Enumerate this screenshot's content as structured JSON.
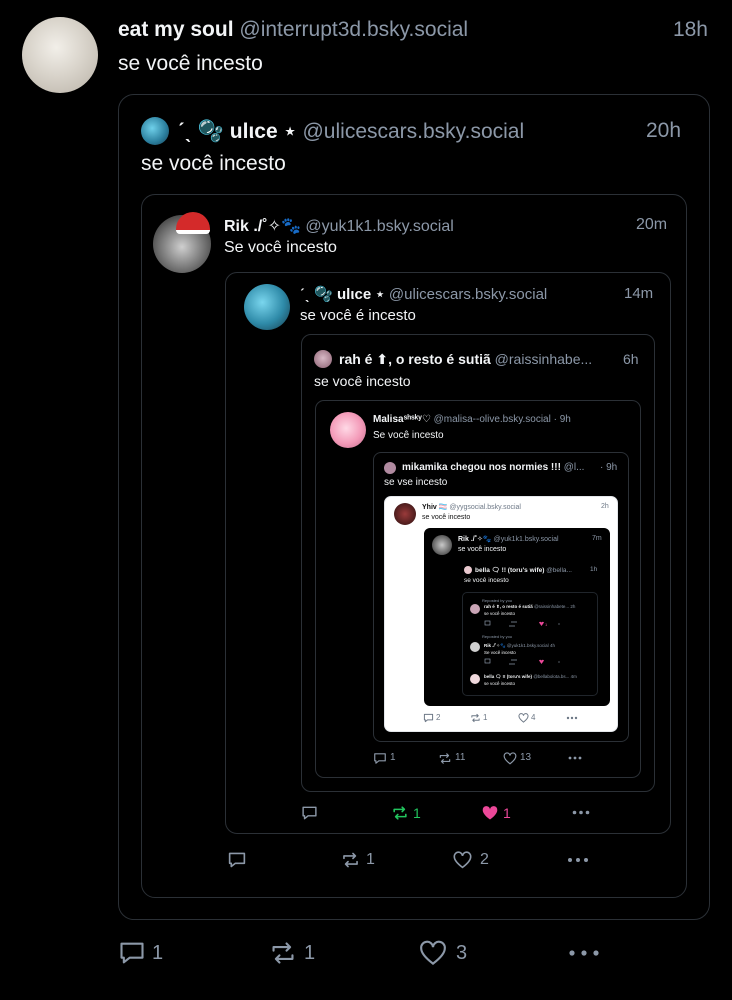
{
  "post": {
    "display_name": "eat my soul",
    "handle": "@interrupt3d.bsky.social",
    "time": "18h",
    "text": "se você incesto",
    "reply_count": "1",
    "repost_count": "1",
    "like_count": "3"
  },
  "q1": {
    "display_name": "ˊˎ 🫧 ulιce ⋆",
    "handle": "@ulicescars.bsky.social",
    "time": "20h",
    "text": "se você incesto"
  },
  "q2": {
    "display_name": "Rik ./˚✧🐾",
    "handle": "@yuk1k1.bsky.social",
    "time": "20m",
    "text": "Se você incesto",
    "reply_count": "",
    "repost_count": "1",
    "like_count": "2"
  },
  "q3": {
    "display_name": "ˊˎ 🫧 ulιce ⋆",
    "handle": "@ulicescars.bsky.social",
    "time": "14m",
    "text": "se você é incesto",
    "reply_count": "",
    "repost_count": "1",
    "like_count": "1"
  },
  "q4": {
    "display_name": "rah é ⬆, o resto é sutiã",
    "handle": "@raissinhabe...",
    "time": "6h",
    "text": "se você incesto"
  },
  "q5": {
    "display_name": "Malisaˢʰˢᵏʸ♡",
    "handle": "@malisa--olive.bsky.social",
    "time": "· 9h",
    "text": "Se você incesto",
    "reply_count": "1",
    "repost_count": "11",
    "like_count": "13"
  },
  "q6": {
    "display_name": "mikamika chegou nos normies !!!",
    "handle": "@l...",
    "time": "· 9h",
    "text": "se vse incesto"
  },
  "q7": {
    "display_name": "Yhiv 🏳️‍⚧️",
    "handle": "@yygsocial.bsky.social",
    "time": "2h",
    "text": "se você incesto",
    "reply_count": "2",
    "repost_count": "1",
    "like_count": "4"
  },
  "q8": {
    "display_name": "Rik ./˚✧🐾",
    "handle": "@yuk1k1.bsky.social",
    "time": "7m",
    "text": "se você incesto"
  },
  "q9": {
    "display_name": "bella 🗨 !! (toru's wife)",
    "handle": "@bella...",
    "time": "1h",
    "text": "se você incesto"
  },
  "tiny": {
    "reposted_by": "Reposted by you",
    "r1_name": "rah é ⬆, o resto é sutiã",
    "r1_handle": "@raissinhabete...",
    "r1_time": "2h",
    "r1_text": "se você incesto",
    "r2_name": "Rik ./˚✧🐾",
    "r2_handle": "@yuk1k1.bsky.social",
    "r2_time": "4h",
    "r2_text": "Se você incesto",
    "r3_name": "bella 🗨 !! (toru's wife)",
    "r3_handle": "@bellabolota.bs...",
    "r3_time": "4m",
    "r3_text": "se você incesto",
    "c_one": "1"
  },
  "colors": {
    "background": "#000000",
    "muted": "#8c98a8",
    "repost_active": "#22c55e",
    "like_active": "#ec4899",
    "border": "#2b3036"
  }
}
